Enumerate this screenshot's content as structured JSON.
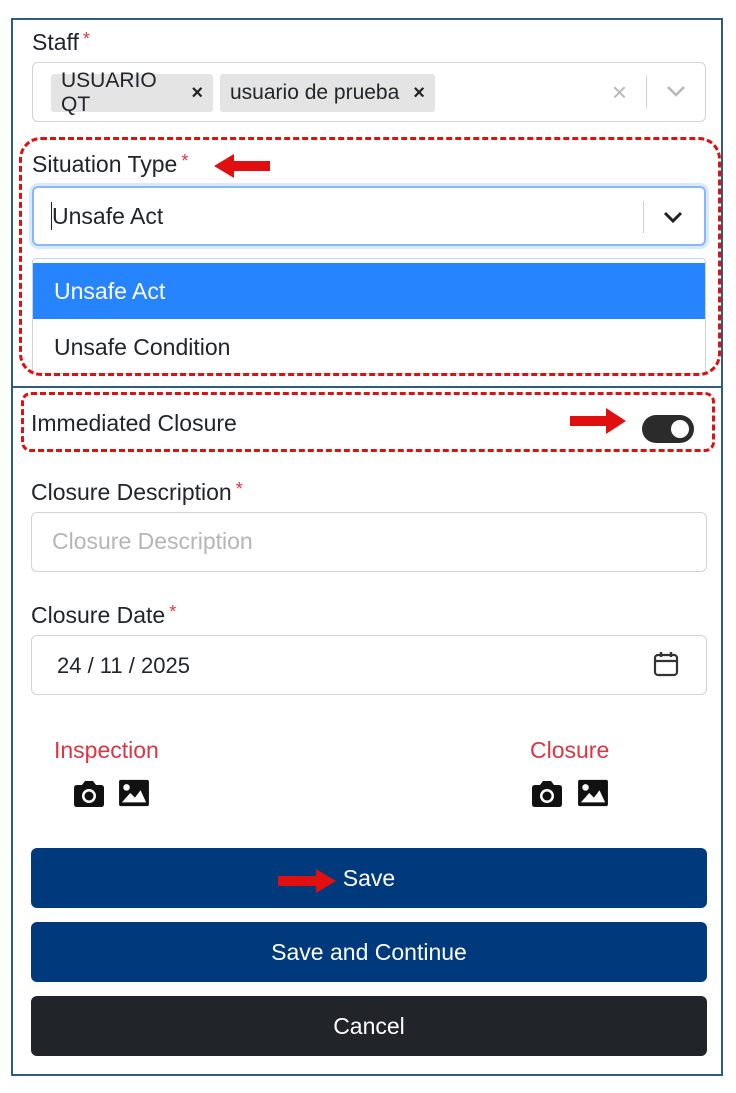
{
  "staff": {
    "label": "Staff",
    "required_mark": "*",
    "chips": [
      {
        "label": "USUARIO QT",
        "remove": "×"
      },
      {
        "label": "usuario de prueba",
        "remove": "×"
      }
    ],
    "clear_all": "×"
  },
  "situation_type": {
    "label": "Situation Type",
    "required_mark": "*",
    "value": "Unsafe Act",
    "options": [
      {
        "label": "Unsafe Act",
        "selected": true
      },
      {
        "label": "Unsafe Condition",
        "selected": false
      }
    ]
  },
  "immediated_closure": {
    "label": "Immediated Closure",
    "enabled": true
  },
  "closure_description": {
    "label": "Closure Description",
    "required_mark": "*",
    "placeholder": "Closure Description",
    "value": ""
  },
  "closure_date": {
    "label": "Closure Date",
    "required_mark": "*",
    "value": "24 / 11 / 2025"
  },
  "photos": {
    "inspection_label": "Inspection",
    "closure_label": "Closure"
  },
  "buttons": {
    "save": "Save",
    "save_continue": "Save and Continue",
    "cancel": "Cancel"
  },
  "colors": {
    "required": "#dc3545",
    "selected_option": "#2684ff",
    "primary_button": "#003a7d",
    "cancel_button": "#212529",
    "annotation": "#e01010",
    "panel_border": "#2e5c80"
  },
  "icons": [
    "close-icon",
    "chevron-down-icon",
    "calendar-icon",
    "camera-icon",
    "image-icon",
    "arrow-right-icon",
    "arrow-left-icon"
  ]
}
